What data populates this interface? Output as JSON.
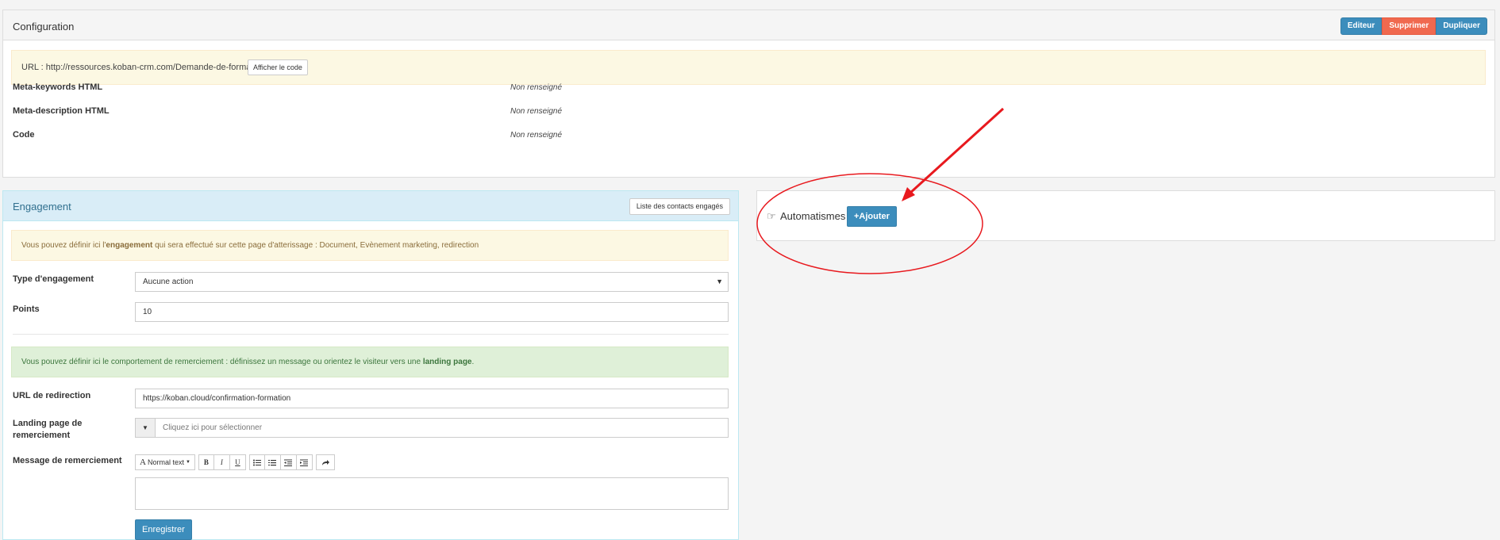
{
  "config": {
    "title": "Configuration",
    "buttons": {
      "editor": "Editeur",
      "delete": "Supprimer",
      "duplicate": "Dupliquer"
    },
    "url_text": "URL : http://ressources.koban-crm.com/Demande-de-formation",
    "show_code": "Afficher le code",
    "meta": [
      {
        "label": "Meta-keywords HTML",
        "value": "Non renseigné"
      },
      {
        "label": "Meta-description HTML",
        "value": "Non renseigné"
      },
      {
        "label": "Code",
        "value": "Non renseigné"
      }
    ]
  },
  "engagement": {
    "title": "Engagement",
    "list_button": "Liste des contacts engagés",
    "info_pre": "Vous pouvez définir ici l'",
    "info_bold": "engagement",
    "info_post": " qui sera effectué sur cette page d'atterissage : Document, Evènement marketing, redirection",
    "type_label": "Type d'engagement",
    "type_value": "Aucune action",
    "points_label": "Points",
    "points_value": "10",
    "thanks_pre": "Vous pouvez définir ici le comportement de remerciement : définissez un message ou orientez le visiteur vers une ",
    "thanks_bold": "landing page",
    "thanks_post": ".",
    "redirect_label": "URL de redirection",
    "redirect_value": "https://koban.cloud/confirmation-formation",
    "landing_label": "Landing page de remerciement",
    "landing_placeholder": "Cliquez ici pour sélectionner",
    "message_label": "Message de remerciement",
    "toolbar": {
      "text_style": "Normal text",
      "bold": "B",
      "italic": "I",
      "underline": "U"
    },
    "save": "Enregistrer"
  },
  "automations": {
    "title": "Automatismes",
    "add": "+Ajouter"
  },
  "colors": {
    "primary": "#3c8dbc",
    "danger": "#f0694f",
    "annotation": "#e8191e"
  }
}
